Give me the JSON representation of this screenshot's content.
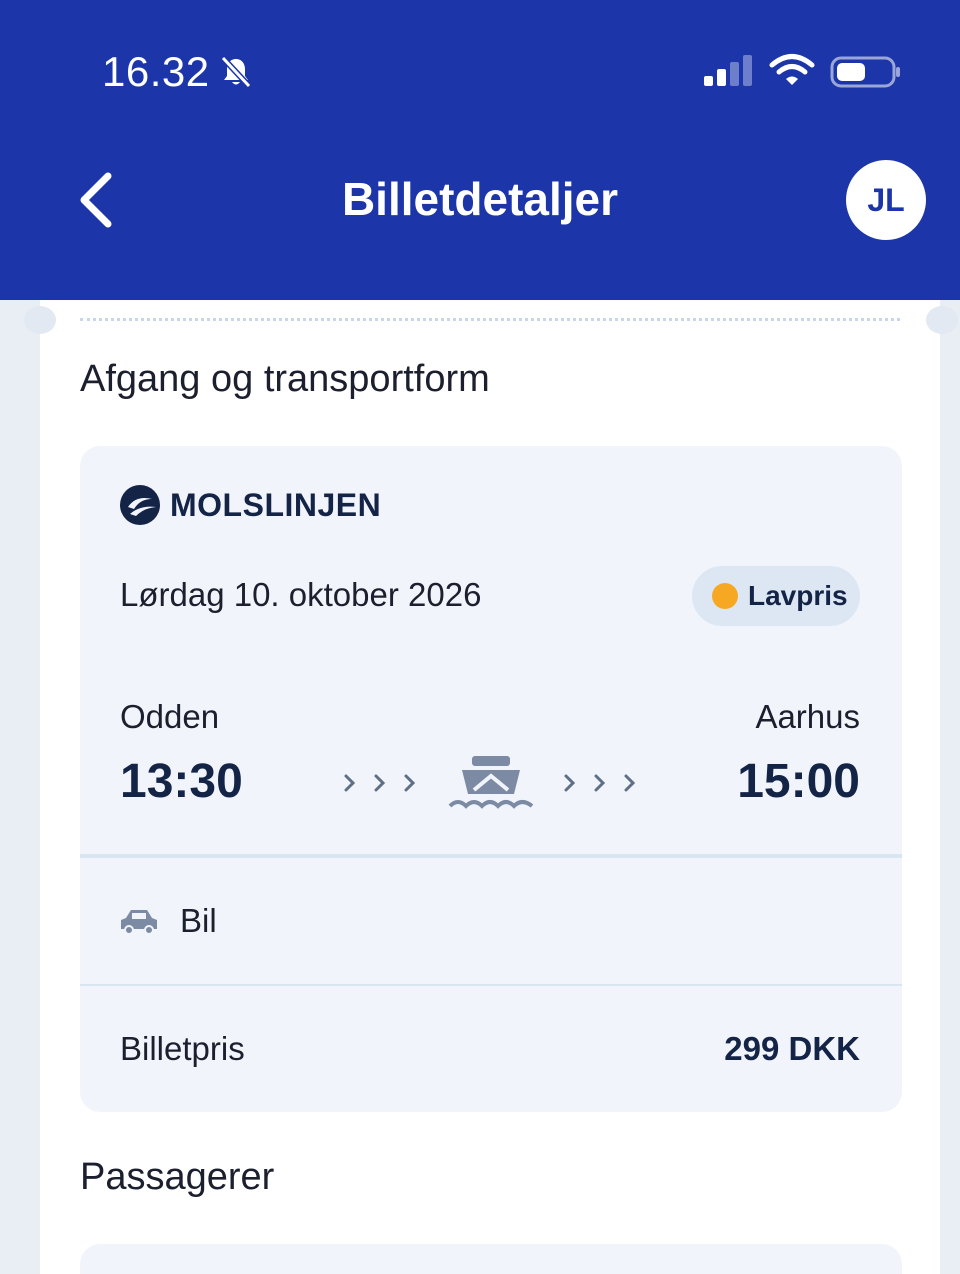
{
  "status_bar": {
    "time": "16.32",
    "icons": [
      "bell-muted-icon",
      "signal-icon",
      "wifi-icon",
      "battery-icon"
    ]
  },
  "header": {
    "title": "Billetdetaljer",
    "avatar_initials": "JL",
    "back_icon": "chevron-left-icon",
    "background_color": "#1c35a8"
  },
  "departure_section": {
    "title": "Afgang og transportform",
    "operator": "MOLSLINJEN",
    "date": "Lørdag 10. oktober 2026",
    "badge": {
      "label": "Lavpris",
      "dot_color": "#f7a823"
    },
    "from": {
      "place": "Odden",
      "time": "13:30"
    },
    "to": {
      "place": "Aarhus",
      "time": "15:00"
    },
    "transport_icon": "ferry-icon",
    "vehicle": {
      "icon": "car-icon",
      "label": "Bil"
    },
    "price": {
      "label": "Billetpris",
      "value": "299 DKK"
    }
  },
  "passengers_section": {
    "title": "Passagerer"
  }
}
